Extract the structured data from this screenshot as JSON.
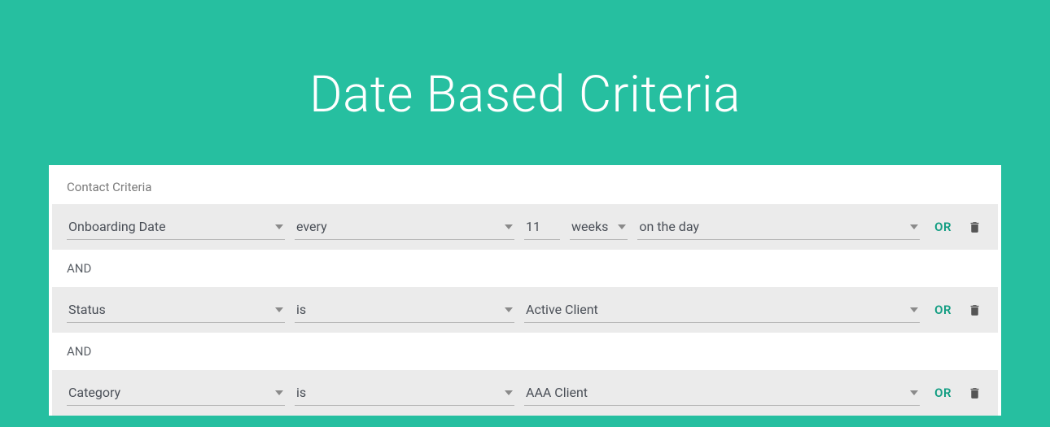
{
  "title": "Date Based Criteria",
  "section_label": "Contact Criteria",
  "and_label": "AND",
  "or_label": "OR",
  "rows": [
    {
      "type": "date",
      "field": "Onboarding Date",
      "operator": "every",
      "number": "11",
      "unit": "weeks",
      "timing": "on the day"
    },
    {
      "type": "simple",
      "field": "Status",
      "operator": "is",
      "value": "Active Client"
    },
    {
      "type": "simple",
      "field": "Category",
      "operator": "is",
      "value": "AAA Client"
    }
  ]
}
